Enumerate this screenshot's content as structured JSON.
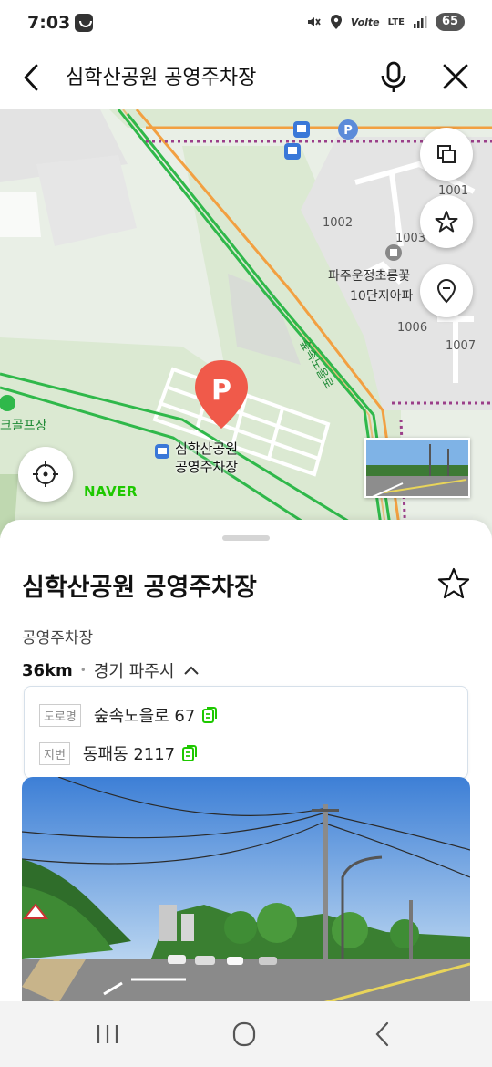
{
  "status": {
    "time": "7:03",
    "network": "LTE",
    "battery": "65"
  },
  "search": {
    "query": "심학산공원 공영주차장"
  },
  "map": {
    "labels": {
      "building_1001": "1001",
      "building_1002": "1002",
      "building_1003": "1003",
      "building_1006": "1006",
      "building_1007": "1007",
      "apartment_line1": "파주운정초롱꽃",
      "apartment_line2": "10단지아파",
      "road": "숲속노을로",
      "golf": "크골프장"
    },
    "pin_label_line1": "심학산공원",
    "pin_label_line2": "공영주차장",
    "logo": "NAVER",
    "buttons": [
      "layers-icon",
      "star-icon",
      "pin-outline-icon",
      "locate-icon"
    ]
  },
  "place": {
    "title": "심학산공원 공영주차장",
    "category": "공영주차장",
    "distance": "36km",
    "region": "경기 파주시",
    "road_tag": "도로명",
    "road_address": "숲속노을로 67",
    "lot_tag": "지번",
    "lot_address": "동패동 2117"
  },
  "colors": {
    "accent_green": "#1ec800",
    "pin_red": "#f05a4a",
    "road_orange": "#f2a041",
    "route_green": "#2fb84a"
  }
}
